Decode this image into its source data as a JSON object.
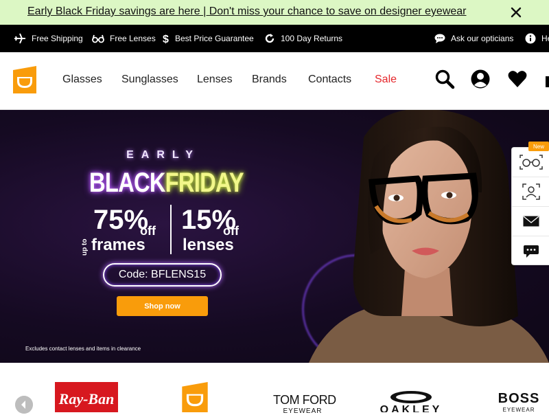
{
  "promo": {
    "text": "Early Black Friday savings are here | Don't miss your chance to save on designer eyewear",
    "close_icon": "close-icon"
  },
  "usp": {
    "items": [
      {
        "icon": "airplane-icon",
        "label": "Free Shipping"
      },
      {
        "icon": "glasses-icon",
        "label": "Free Lenses"
      },
      {
        "icon": "dollar-icon",
        "label": "Best Price Guarantee"
      },
      {
        "icon": "refresh-icon",
        "label": "100 Day Returns"
      }
    ],
    "ask_label": "Ask our opticians",
    "help_label": "He"
  },
  "header": {
    "nav": [
      "Glasses",
      "Sunglasses",
      "Lenses",
      "Brands",
      "Contacts",
      "Sale"
    ],
    "sale_color": "#e5262b",
    "icons": [
      "search-icon",
      "account-icon",
      "heart-icon",
      "cart-icon"
    ]
  },
  "hero": {
    "early": "EARLY",
    "title_black": "BLACK",
    "title_friday": "FRIDAY",
    "up_to": "up to",
    "pct1": "75%",
    "off1": "off",
    "item1": "frames",
    "pct2": "15%",
    "off2": "off",
    "item2": "lenses",
    "code": "Code: BFLENS15",
    "cta": "Shop now",
    "disclaimer": "Excludes contact lenses and items in clearance",
    "accent": "#f99c0b"
  },
  "tools": {
    "badge": "New",
    "items": [
      "virtual-try-on-icon",
      "face-scan-icon",
      "email-icon",
      "chat-icon"
    ]
  },
  "brands": {
    "items": [
      "Ray-Ban",
      "Glasses Direct",
      "TOM FORD",
      "OAKLEY",
      "BOSS"
    ],
    "tomford_sub": "EYEWEAR",
    "boss_sub": "EYEWEAR",
    "prev_icon": "chevron-left-icon"
  }
}
